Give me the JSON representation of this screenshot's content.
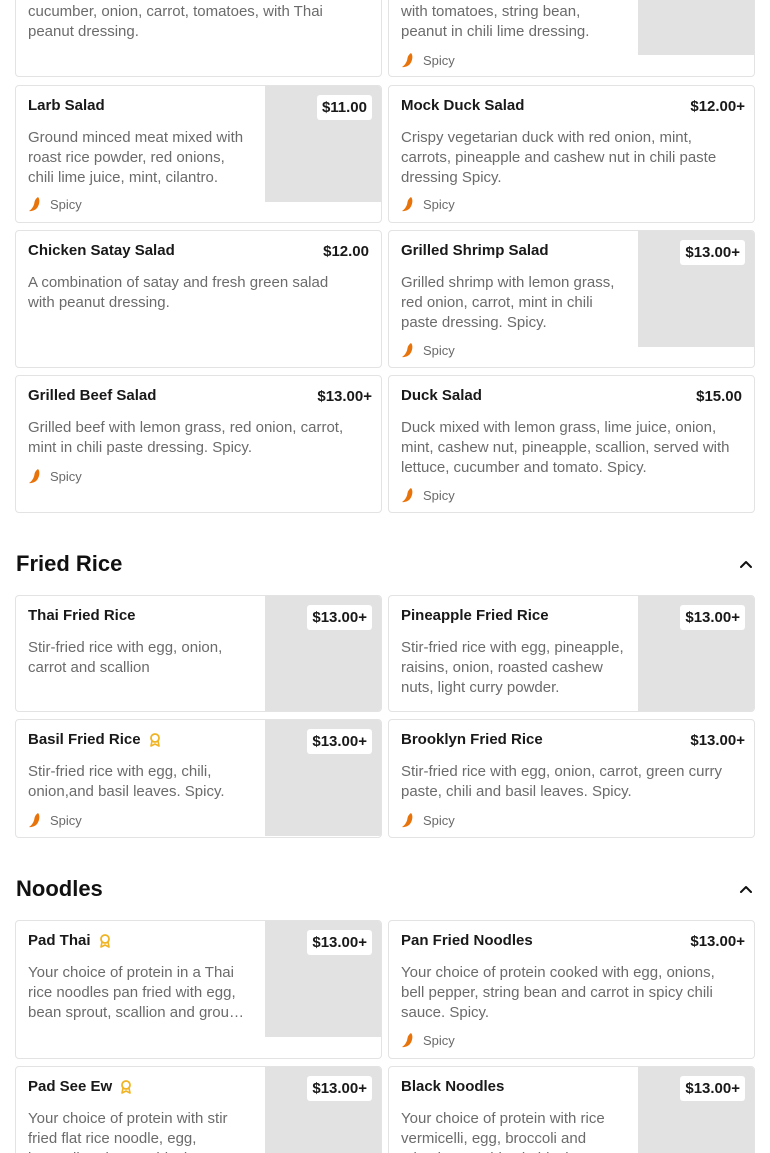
{
  "colors": {
    "spicy": "#e8730a",
    "badge": "#f0b323",
    "image_placeholder": "#e2e2e2",
    "text_muted": "#6b6b6b"
  },
  "icons": {
    "spicy": "chili-pepper-icon",
    "popular": "ribbon-award-icon",
    "collapse": "chevron-up-icon"
  },
  "spicy_label": "Spicy",
  "top_fragment": {
    "left_desc": "cucumber, onion, carrot, tomatoes, with Thai peanut dressing.",
    "right_desc": "with tomatoes, string bean, peanut in chili lime dressing."
  },
  "salads": [
    {
      "name": "Larb Salad",
      "price": "$11.00",
      "desc": "Ground minced meat mixed with roast rice powder, red onions, chili lime juice, mint, cilantro.",
      "spicy": true
    },
    {
      "name": "Mock Duck Salad",
      "price": "$12.00+",
      "desc": "Crispy vegetarian duck with red onion, mint, carrots, pineapple and cashew nut in chili paste dressing Spicy.",
      "spicy": true
    },
    {
      "name": "Chicken Satay Salad",
      "price": "$12.00",
      "desc": "A combination of satay and fresh green salad with peanut dressing.",
      "spicy": false
    },
    {
      "name": "Grilled Shrimp Salad",
      "price": "$13.00+",
      "desc": "Grilled shrimp with lemon grass, red onion, carrot, mint in chili paste dressing. Spicy.",
      "spicy": true
    },
    {
      "name": "Grilled Beef Salad",
      "price": "$13.00+",
      "desc": "Grilled beef with lemon grass, red onion, carrot, mint in chili paste dressing. Spicy.",
      "spicy": true
    },
    {
      "name": "Duck Salad",
      "price": "$15.00",
      "desc": "Duck mixed with lemon grass, lime juice, onion, mint, cashew nut, pineapple, scallion, served with lettuce, cucumber and tomato. Spicy.",
      "spicy": true
    }
  ],
  "fried_rice": {
    "title": "Fried Rice",
    "items": [
      {
        "name": "Thai Fried Rice",
        "price": "$13.00+",
        "desc": "Stir-fried rice with egg, onion, carrot and scallion"
      },
      {
        "name": "Pineapple Fried Rice",
        "price": "$13.00+",
        "desc": "Stir-fried rice with egg, pineapple, raisins, onion, roasted cashew nuts, light curry powder."
      },
      {
        "name": "Basil Fried Rice",
        "price": "$13.00+",
        "desc": "Stir-fried rice with egg, chili, onion,and basil leaves. Spicy."
      },
      {
        "name": "Brooklyn Fried Rice",
        "price": "$13.00+",
        "desc": "Stir-fried rice with egg, onion, carrot, green curry paste, chili and basil leaves. Spicy."
      }
    ]
  },
  "noodles": {
    "title": "Noodles",
    "items": [
      {
        "name": "Pad Thai",
        "price": "$13.00+",
        "desc": "Your choice of protein in a Thai rice noodles pan fried with egg, bean sprout, scallion and ground peanuts."
      },
      {
        "name": "Pan Fried Noodles",
        "price": "$13.00+",
        "desc": "Your choice of protein cooked with egg, onions, bell pepper, string bean and carrot in spicy chili sauce. Spicy."
      },
      {
        "name": "Pad See Ew",
        "price": "$13.00+",
        "desc": "Your choice of protein with stir fried flat rice noodle, egg, broccoli and sweet black soy sauce."
      },
      {
        "name": "Black Noodles",
        "price": "$13.00+",
        "desc": "Your choice of protein with rice vermicelli, egg, broccoli and mixed vegetables in black soy sauce."
      }
    ]
  }
}
